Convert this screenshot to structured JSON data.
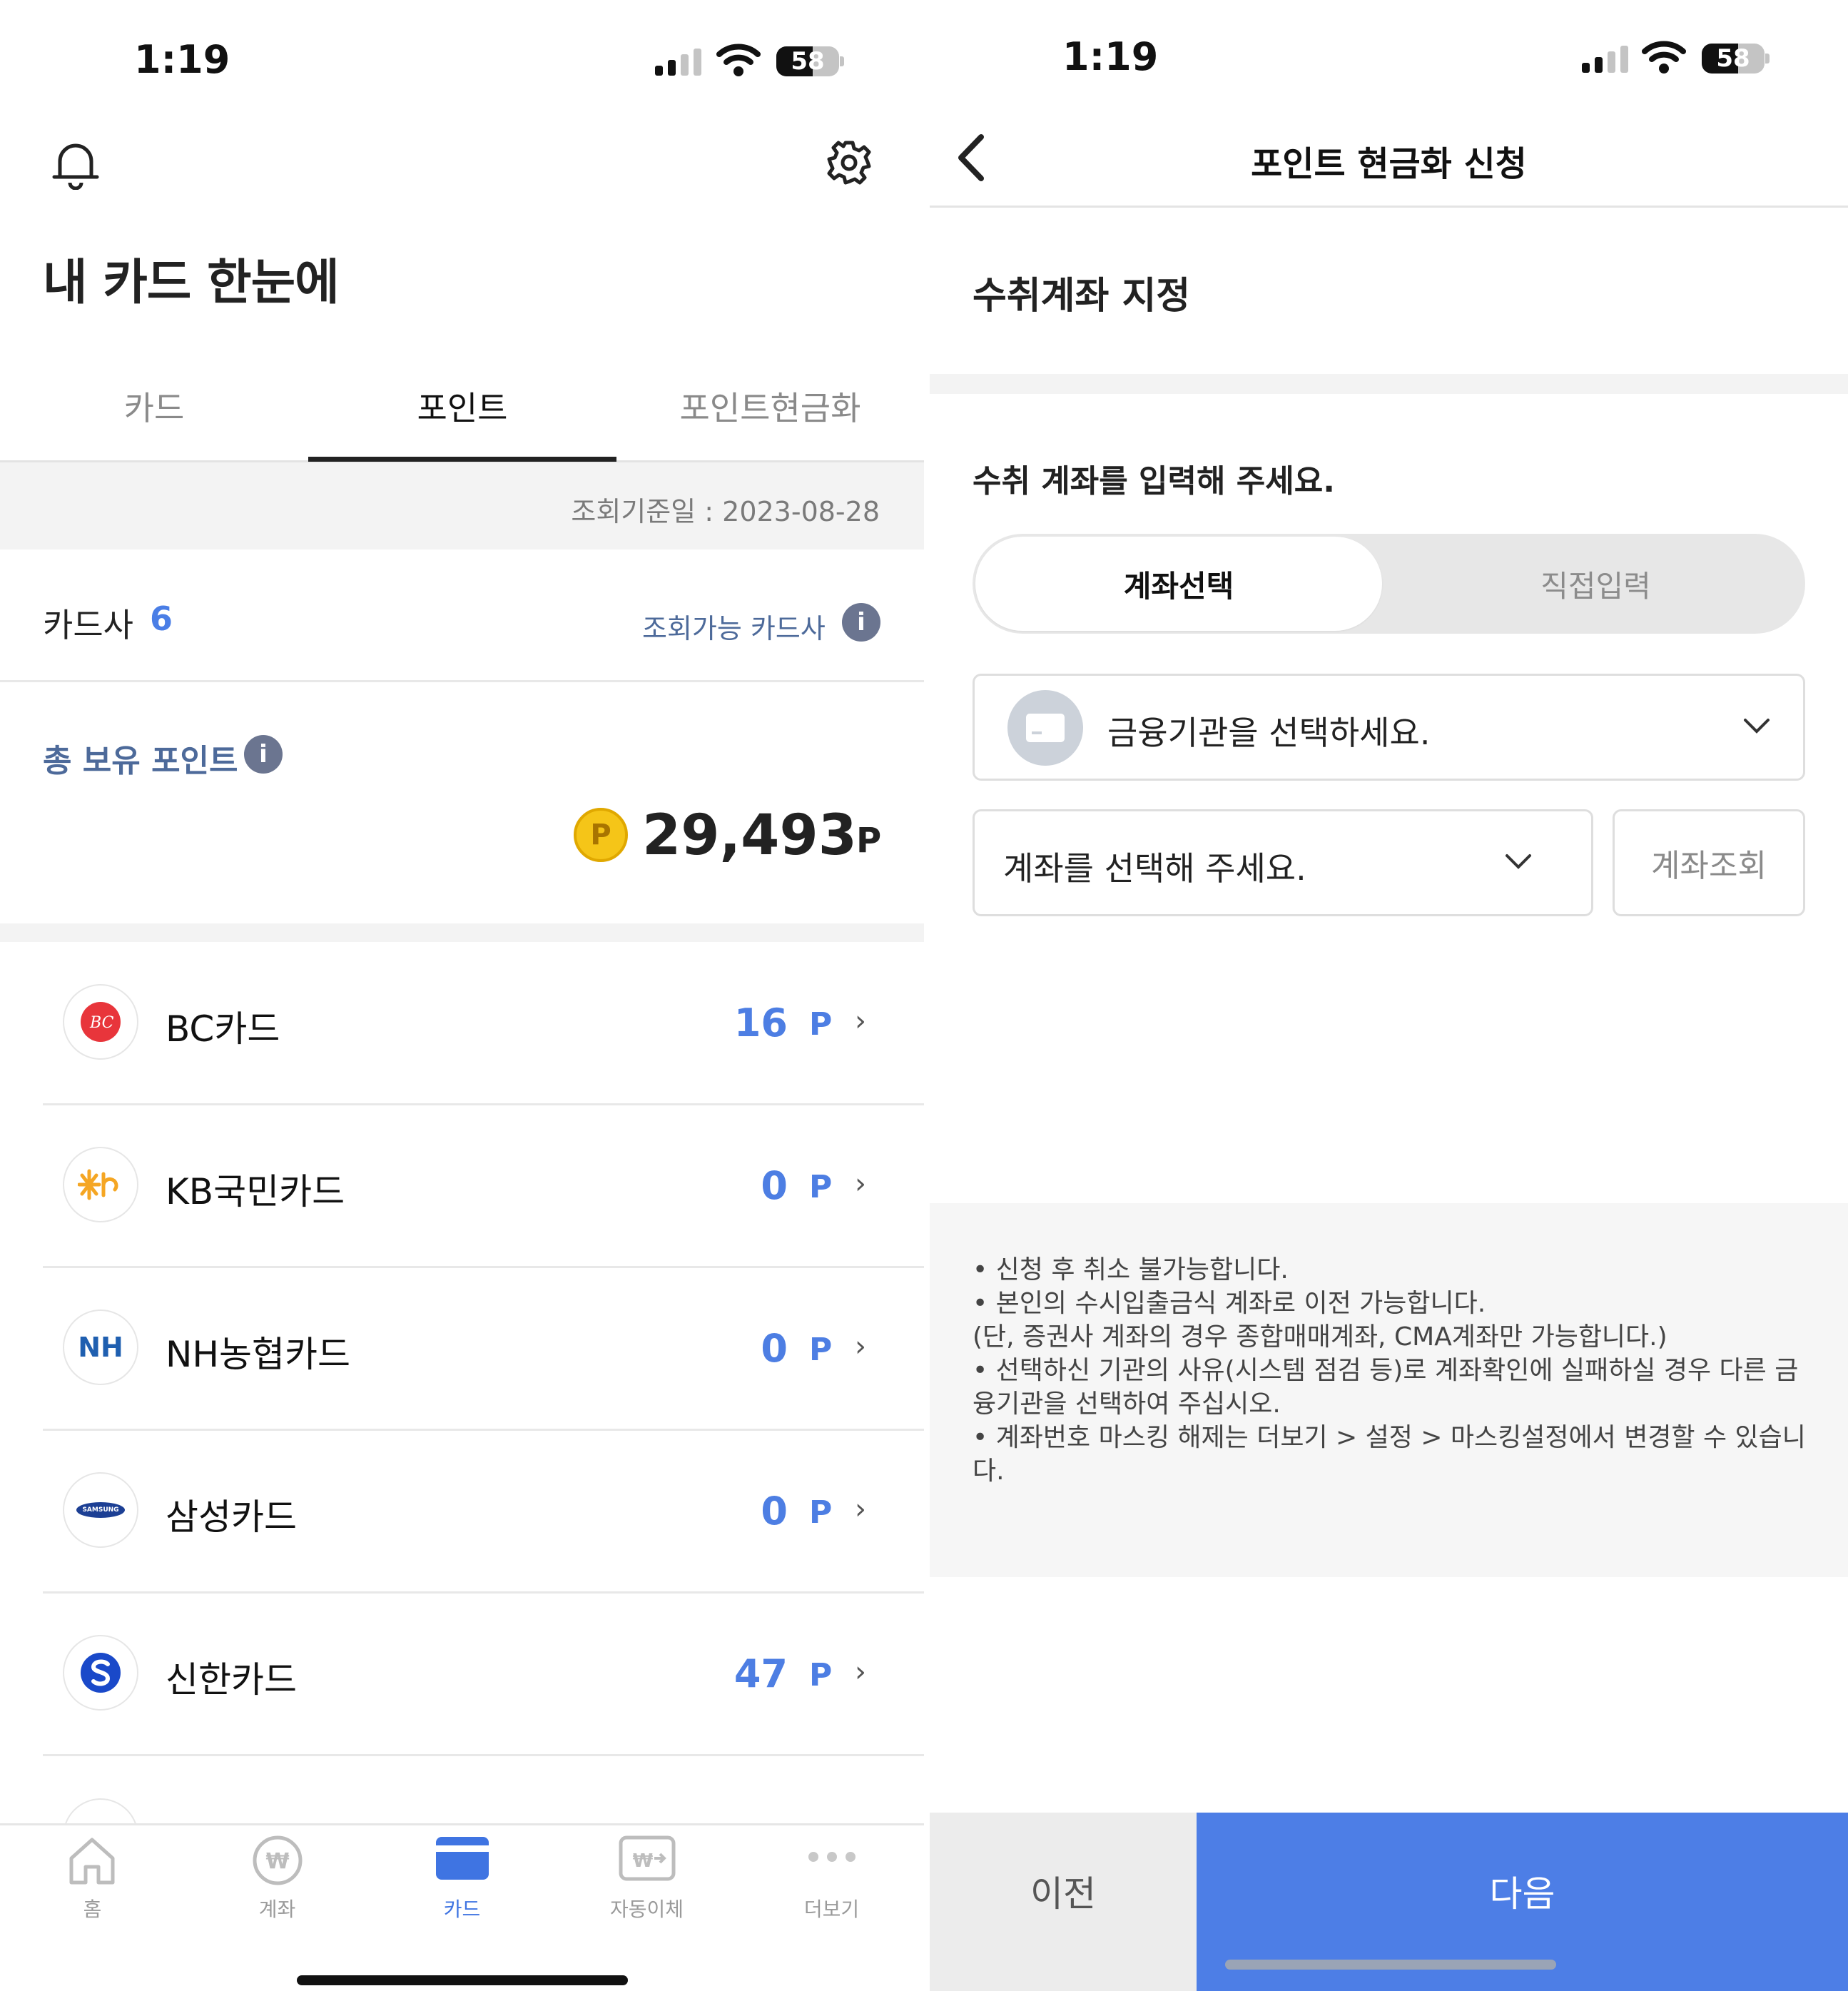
{
  "left": {
    "status": {
      "time": "1:19",
      "battery": "58"
    },
    "page_title": "내 카드 한눈에",
    "tabs": [
      {
        "label": "카드",
        "active": false
      },
      {
        "label": "포인트",
        "active": true
      },
      {
        "label": "포인트현금화",
        "active": false
      }
    ],
    "query_date": "조회기준일 : 2023-08-28",
    "card_company_label": "카드사",
    "card_company_count": "6",
    "available_link": "조회가능 카드사",
    "total_label": "총 보유 포인트",
    "total_points": "29,493",
    "point_unit": "P",
    "coin_letter": "P",
    "info_letter": "i",
    "cards": [
      {
        "name": "BC카드",
        "points": "16",
        "unit": "P",
        "logo": "bc-logo-icon"
      },
      {
        "name": "KB국민카드",
        "points": "0",
        "unit": "P",
        "logo": "kb-logo-icon"
      },
      {
        "name": "NH농협카드",
        "points": "0",
        "unit": "P",
        "logo": "nh-logo-icon",
        "logo_text": "NH"
      },
      {
        "name": "삼성카드",
        "points": "0",
        "unit": "P",
        "logo": "samsung-logo-icon",
        "logo_text": "SAMSUNG"
      },
      {
        "name": "신한카드",
        "points": "47",
        "unit": "P",
        "logo": "shinhan-logo-icon"
      }
    ],
    "nav": [
      {
        "label": "홈",
        "icon": "home-icon",
        "active": false
      },
      {
        "label": "계좌",
        "icon": "won-coin-icon",
        "active": false
      },
      {
        "label": "카드",
        "icon": "card-icon",
        "active": true
      },
      {
        "label": "자동이체",
        "icon": "auto-transfer-icon",
        "active": false
      },
      {
        "label": "더보기",
        "icon": "more-dots-icon",
        "active": false
      }
    ]
  },
  "right": {
    "status": {
      "time": "1:19",
      "battery": "58"
    },
    "header_title": "포인트 현금화 신청",
    "section_title": "수취계좌 지정",
    "prompt": "수취 계좌를 입력해 주세요.",
    "segments": {
      "select": "계좌선택",
      "manual": "직접입력"
    },
    "institution_placeholder": "금융기관을 선택하세요.",
    "account_placeholder": "계좌를 선택해 주세요.",
    "lookup_button": "계좌조회",
    "notices": [
      "• 신청 후 취소 불가능합니다.",
      "• 본인의 수시입출금식 계좌로 이전 가능합니다.",
      "(단, 증권사 계좌의 경우 종합매매계좌, CMA계좌만 가능합니다.)",
      "• 선택하신 기관의 사유(시스템 점검 등)로 계좌확인에 실패하실 경우 다른 금",
      "융기관을 선택하여 주십시오.",
      "• 계좌번호 마스킹 해제는 더보기 > 설정 > 마스킹설정에서 변경할 수 있습니",
      "다."
    ],
    "prev_button": "이전",
    "next_button": "다음"
  },
  "colors": {
    "accent": "#4d7ee6",
    "text": "#222222",
    "muted": "#8a8a8a",
    "coin": "#f5c518"
  }
}
